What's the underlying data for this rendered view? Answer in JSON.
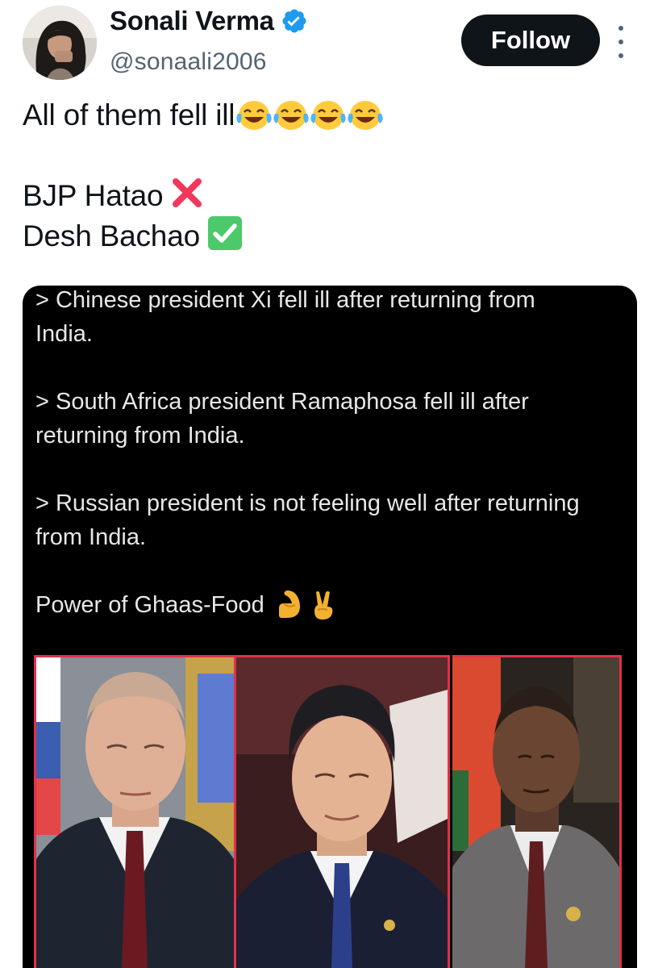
{
  "author": {
    "display_name": "Sonali Verma",
    "handle": "@sonaali2006",
    "avatar_icon": "avatar-photo",
    "verified_icon": "verified-badge-icon",
    "verified_color": "#1d9bf0"
  },
  "actions": {
    "follow_label": "Follow",
    "more_icon": "more-options-icon"
  },
  "tweet": {
    "line1": "All of them fell ill",
    "line1_emojis": [
      "face-with-tears-of-joy",
      "face-with-tears-of-joy",
      "face-with-tears-of-joy",
      "face-with-tears-of-joy"
    ],
    "line2": "BJP Hatao",
    "line2_emoji": "cross-mark",
    "line3": "Desh Bachao",
    "line3_emoji": "check-mark-button"
  },
  "media": {
    "caption": {
      "p1_line1": "> Chinese president Xi fell ill after returning from",
      "p1_line2": "India.",
      "p2_line1": "> South Africa president Ramaphosa fell ill after",
      "p2_line2": "returning from India.",
      "p3_line1": "> Russian president is not feeling well after returning",
      "p3_line2": "from India.",
      "closing": "Power of Ghaas-Food",
      "closing_emojis": [
        "flexed-biceps",
        "victory-hand"
      ]
    },
    "photos": [
      "portrait-photo-1",
      "portrait-photo-2",
      "portrait-photo-3"
    ],
    "frame_color": "#e0314a"
  },
  "colors": {
    "text_primary": "#0f1419",
    "text_secondary": "#536471",
    "follow_bg": "#0f1419",
    "media_bg": "#000000"
  }
}
